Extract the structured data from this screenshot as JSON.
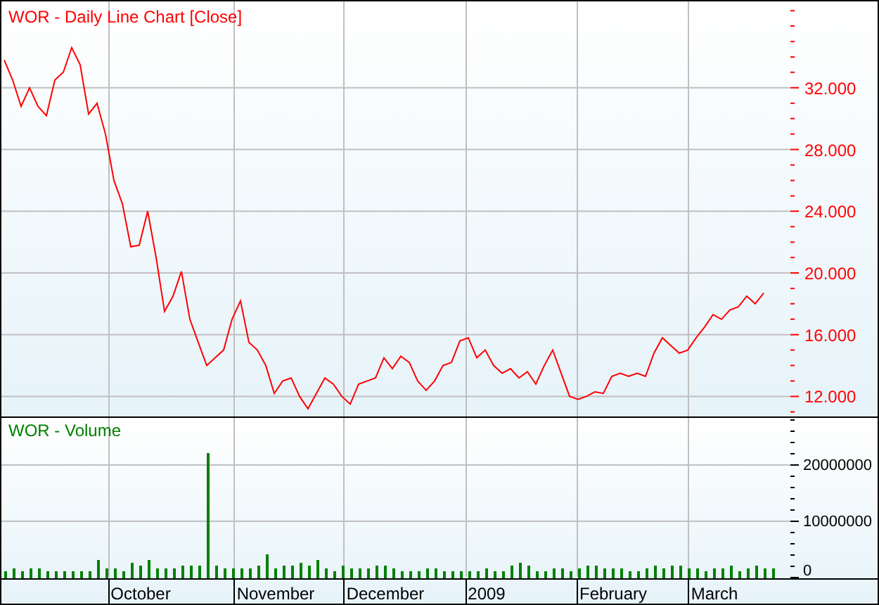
{
  "price_panel": {
    "chart_data": {
      "type": "line",
      "title": "WOR - Daily Line Chart [Close]",
      "grid": true,
      "ylim": [
        10700,
        37600
      ],
      "yticks": [
        {
          "value": 12000,
          "label": "12.000"
        },
        {
          "value": 16000,
          "label": "16.000"
        },
        {
          "value": 20000,
          "label": "20.000"
        },
        {
          "value": 24000,
          "label": "24.000"
        },
        {
          "value": 28000,
          "label": "28.000"
        },
        {
          "value": 32000,
          "label": "32.000"
        }
      ],
      "series": [
        {
          "color": "#ff0000",
          "values": [
            33800,
            32500,
            30800,
            32000,
            30800,
            30200,
            32500,
            33000,
            34600,
            33500,
            30300,
            31000,
            29000,
            26000,
            24500,
            21700,
            21800,
            24000,
            21000,
            17500,
            18500,
            20100,
            17000,
            15500,
            14000,
            14500,
            15000,
            17000,
            18200,
            15500,
            15000,
            14000,
            12200,
            13000,
            13200,
            12000,
            11200,
            12200,
            13200,
            12800,
            12000,
            11500,
            12800,
            13000,
            13200,
            14500,
            13800,
            14600,
            14200,
            13000,
            12400,
            13000,
            14000,
            14200,
            15600,
            15800,
            14500,
            15000,
            14000,
            13500,
            13800,
            13200,
            13600,
            12800,
            14000,
            15000,
            13500,
            12000,
            11800,
            12000,
            12300,
            12200,
            13300,
            13500,
            13300,
            13500,
            13300,
            14800,
            15800,
            15300,
            14800,
            15000,
            15800,
            16500,
            17300,
            17000,
            17600,
            17800,
            18500,
            18000,
            18700
          ]
        }
      ]
    }
  },
  "volume_panel": {
    "chart_data": {
      "type": "bar",
      "title": "WOR - Volume",
      "grid": true,
      "ylim": [
        0,
        28500000
      ],
      "yticks": [
        {
          "value": 0,
          "label": "0"
        },
        {
          "value": 10000000,
          "label": "10000000"
        },
        {
          "value": 20000000,
          "label": "20000000"
        }
      ],
      "categories": [
        null,
        null,
        null,
        null,
        null,
        null,
        null,
        null,
        null,
        null,
        null,
        null,
        null,
        null,
        null,
        null,
        "October",
        null,
        null,
        null,
        null,
        null,
        null,
        null,
        null,
        null,
        null,
        null,
        null,
        null,
        null,
        null,
        "November",
        null,
        null,
        null,
        null,
        null,
        null,
        null,
        null,
        null,
        null,
        null,
        null,
        "December",
        null,
        null,
        null,
        null,
        null,
        null,
        null,
        null,
        null,
        null,
        null,
        "2009",
        null,
        null,
        null,
        null,
        null,
        null,
        null,
        null,
        null,
        null,
        null,
        null,
        null,
        null,
        "February",
        null,
        null,
        null,
        null,
        null,
        null,
        null,
        null,
        null,
        null,
        null,
        "March",
        null,
        null,
        null,
        null,
        null,
        null,
        null
      ],
      "series": [
        {
          "color": "#008000",
          "values": [
            1000000,
            1500000,
            1000000,
            1500000,
            1500000,
            1000000,
            1000000,
            1000000,
            1000000,
            1000000,
            1000000,
            3000000,
            1500000,
            1500000,
            1000000,
            2500000,
            2000000,
            3000000,
            1500000,
            1500000,
            1500000,
            2000000,
            2000000,
            2000000,
            22000000,
            2000000,
            1500000,
            1500000,
            1500000,
            1500000,
            2000000,
            4000000,
            1500000,
            2000000,
            2000000,
            2500000,
            2000000,
            3000000,
            1500000,
            1000000,
            2000000,
            1500000,
            1500000,
            1500000,
            2000000,
            2000000,
            1500000,
            1000000,
            1000000,
            1000000,
            1500000,
            1500000,
            1000000,
            1000000,
            1000000,
            1000000,
            1000000,
            1500000,
            1000000,
            1000000,
            2000000,
            2500000,
            2000000,
            1000000,
            1000000,
            1500000,
            1500000,
            1000000,
            1500000,
            2000000,
            2000000,
            1500000,
            1500000,
            1500000,
            1000000,
            1000000,
            1500000,
            2000000,
            1500000,
            2000000,
            2000000,
            1500000,
            1500000,
            1000000,
            1500000,
            1500000,
            2000000,
            1000000,
            1500000,
            2000000,
            1500000,
            1500000
          ]
        }
      ]
    }
  }
}
